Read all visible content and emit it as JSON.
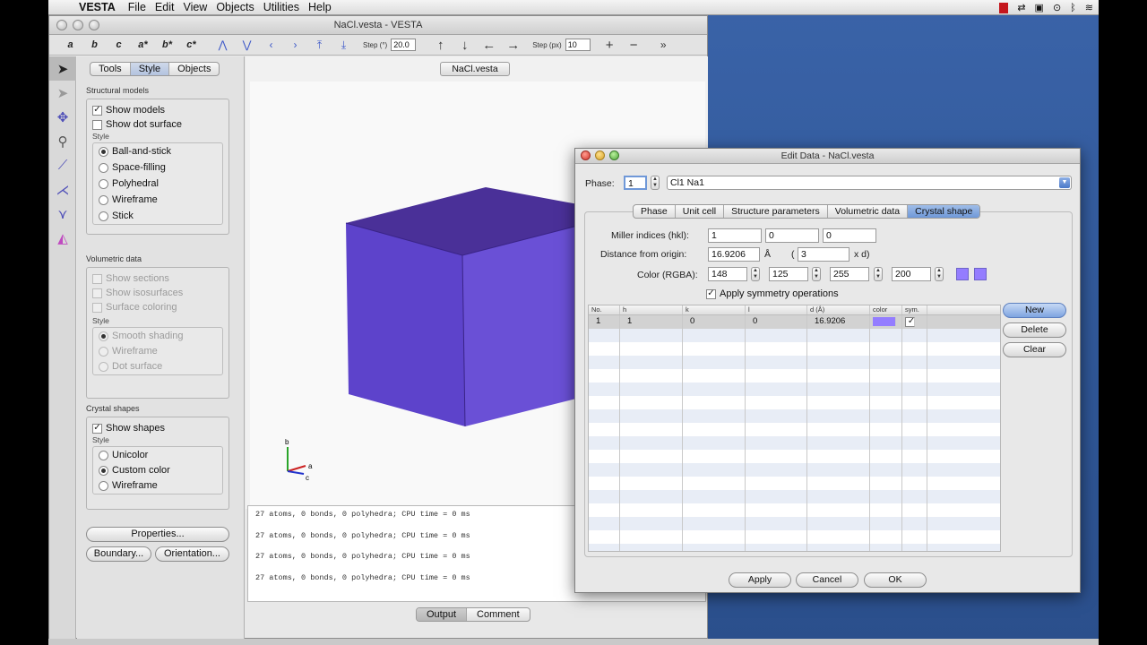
{
  "menubar": {
    "app": "VESTA",
    "items": [
      "File",
      "Edit",
      "View",
      "Objects",
      "Utilities",
      "Help"
    ]
  },
  "main_window": {
    "title": "NaCl.vesta - VESTA",
    "toolbar": {
      "axes": [
        "a",
        "b",
        "c",
        "a*",
        "b*",
        "c*"
      ],
      "step_deg_label": "Step (°)",
      "step_deg_value": "20.0",
      "step_px_label": "Step (px)",
      "step_px_value": "10"
    },
    "side_tabs": [
      "Tools",
      "Style",
      "Objects"
    ],
    "structural_models": {
      "title": "Structural models",
      "show_models": "Show models",
      "show_dot_surface": "Show dot surface",
      "style_label": "Style",
      "styles": [
        "Ball-and-stick",
        "Space-filling",
        "Polyhedral",
        "Wireframe",
        "Stick"
      ]
    },
    "volumetric_data": {
      "title": "Volumetric data",
      "show_sections": "Show sections",
      "show_isosurfaces": "Show isosurfaces",
      "surface_coloring": "Surface coloring",
      "style_label": "Style",
      "styles": [
        "Smooth shading",
        "Wireframe",
        "Dot surface"
      ]
    },
    "crystal_shapes": {
      "title": "Crystal shapes",
      "show_shapes": "Show shapes",
      "style_label": "Style",
      "styles": [
        "Unicolor",
        "Custom color",
        "Wireframe"
      ]
    },
    "buttons": {
      "properties": "Properties...",
      "boundary": "Boundary...",
      "orientation": "Orientation..."
    },
    "view_tab": "NaCl.vesta",
    "axis_labels": {
      "b": "b",
      "a": "a",
      "c": "c"
    },
    "output_lines": [
      "27 atoms, 0 bonds, 0 polyhedra; CPU time = 0 ms",
      "27 atoms, 0 bonds, 0 polyhedra; CPU time = 0 ms",
      "27 atoms, 0 bonds, 0 polyhedra; CPU time = 0 ms",
      "27 atoms, 0 bonds, 0 polyhedra; CPU time = 0 ms"
    ],
    "output_tabs": [
      "Output",
      "Comment"
    ]
  },
  "dialog": {
    "title": "Edit Data - NaCl.vesta",
    "phase_label": "Phase:",
    "phase_value": "1",
    "phase_name": "Cl1 Na1",
    "tabs": [
      "Phase",
      "Unit cell",
      "Structure parameters",
      "Volumetric data",
      "Crystal shape"
    ],
    "active_tab": "Crystal shape",
    "miller_label": "Miller indices (hkl):",
    "miller": [
      "1",
      "0",
      "0"
    ],
    "distance_label": "Distance from origin:",
    "distance_value": "16.9206",
    "distance_unit": "Å",
    "paren": "(",
    "multiplier": "3",
    "times_d": "x d)",
    "color_label": "Color (RGBA):",
    "rgba": [
      "148",
      "125",
      "255",
      "200"
    ],
    "apply_symmetry": "Apply symmetry operations",
    "table_headers": [
      "No.",
      "h",
      "k",
      "l",
      "d (Å)",
      "color",
      "sym."
    ],
    "table_rows": [
      {
        "no": "1",
        "h": "1",
        "k": "0",
        "l": "0",
        "d": "16.9206",
        "color": "#947dff",
        "sym": true
      }
    ],
    "side_buttons": [
      "New",
      "Delete",
      "Clear"
    ],
    "footer_buttons": [
      "Apply",
      "Cancel",
      "OK"
    ]
  },
  "colors": {
    "crystal": "#5b3fc9",
    "swatch": "#947dff",
    "desktop": "#35599a"
  }
}
